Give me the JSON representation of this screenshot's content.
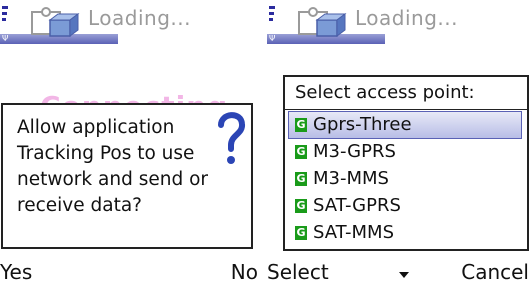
{
  "left": {
    "header_title": "Loading...",
    "background_text": "Connecting",
    "dialog_text": "Allow application Tracking Pos to use network and send or receive data?",
    "dialog_icon": "question-mark-icon",
    "softkey_left": "Yes",
    "softkey_right": "No"
  },
  "right": {
    "header_title": "Loading...",
    "list_title": "Select access point:",
    "items": [
      {
        "label": "Gprs-Three",
        "selected": true
      },
      {
        "label": "M3-GPRS",
        "selected": false
      },
      {
        "label": "M3-MMS",
        "selected": false
      },
      {
        "label": "SAT-GPRS",
        "selected": false
      },
      {
        "label": "SAT-MMS",
        "selected": false
      }
    ],
    "softkey_left": "Select",
    "softkey_right": "Cancel"
  },
  "colors": {
    "header_strip": "#5a61b5",
    "selection": "#b8bde6",
    "g_icon": "#1a9b1a",
    "question_icon": "#2b45b5"
  }
}
